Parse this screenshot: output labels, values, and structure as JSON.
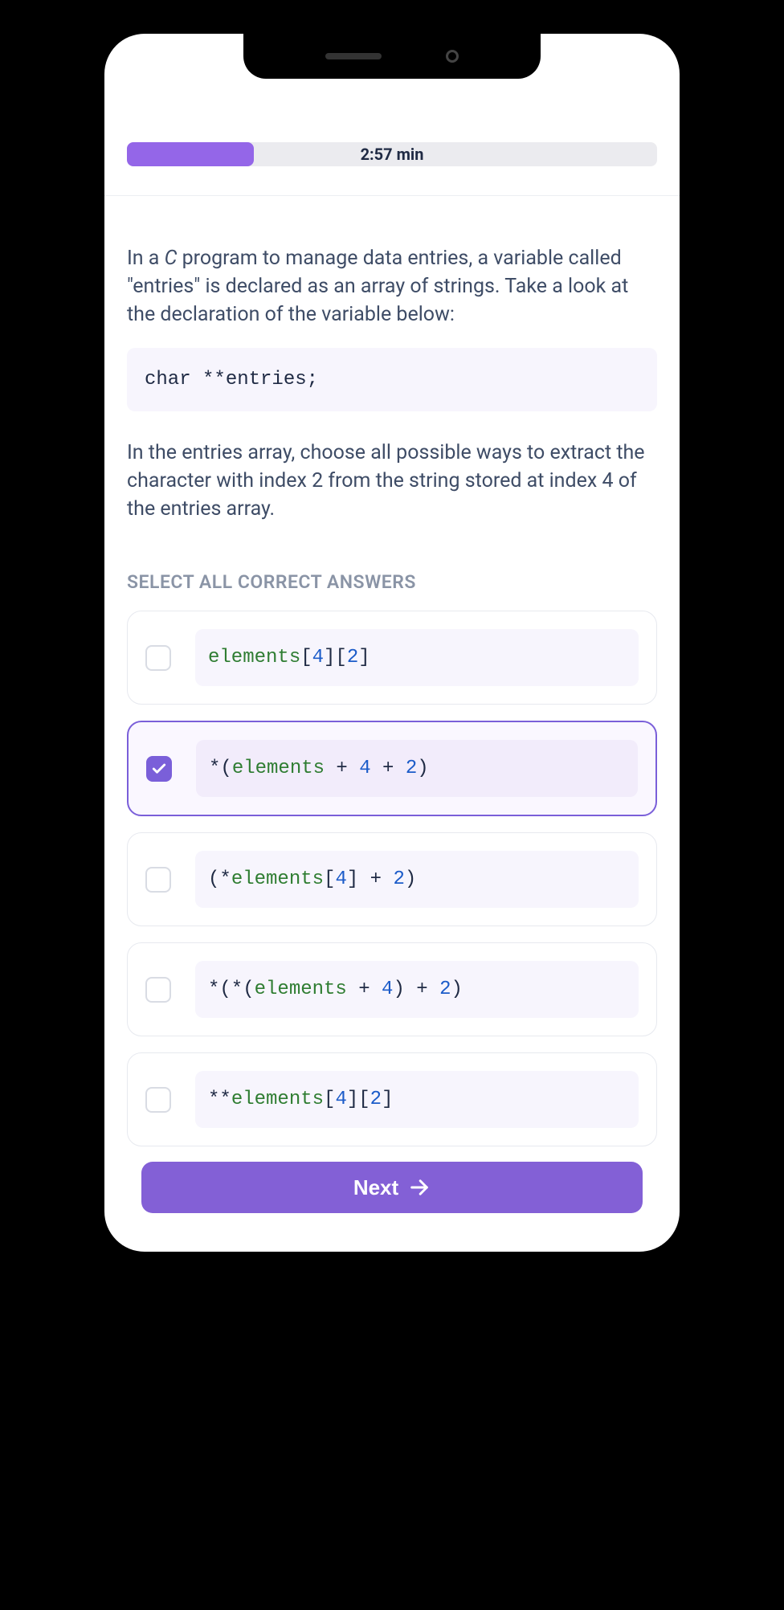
{
  "progress": {
    "time_label": "2:57 min",
    "fill_percent": 24
  },
  "question": {
    "para1_prefix": "In a ",
    "para1_lang": "C",
    "para1_rest": " program to manage data entries, a variable called \"entries\" is declared as an array of strings. Take a look at the declaration of the variable below:",
    "code_decl": "char **entries;",
    "para2": "In the entries array, choose all possible ways to extract the character with index 2 from the string stored at index 4 of the entries array."
  },
  "section_label": "SELECT ALL CORRECT ANSWERS",
  "options": [
    {
      "selected": false,
      "tokens": [
        {
          "t": "ident",
          "v": "elements"
        },
        {
          "t": "plain",
          "v": "["
        },
        {
          "t": "num",
          "v": "4"
        },
        {
          "t": "plain",
          "v": "]["
        },
        {
          "t": "num",
          "v": "2"
        },
        {
          "t": "plain",
          "v": "]"
        }
      ]
    },
    {
      "selected": true,
      "tokens": [
        {
          "t": "plain",
          "v": "*("
        },
        {
          "t": "ident",
          "v": "elements"
        },
        {
          "t": "plain",
          "v": " + "
        },
        {
          "t": "num",
          "v": "4"
        },
        {
          "t": "plain",
          "v": " + "
        },
        {
          "t": "num",
          "v": "2"
        },
        {
          "t": "plain",
          "v": ")"
        }
      ]
    },
    {
      "selected": false,
      "tokens": [
        {
          "t": "plain",
          "v": "(*"
        },
        {
          "t": "ident",
          "v": "elements"
        },
        {
          "t": "plain",
          "v": "["
        },
        {
          "t": "num",
          "v": "4"
        },
        {
          "t": "plain",
          "v": "] + "
        },
        {
          "t": "num",
          "v": "2"
        },
        {
          "t": "plain",
          "v": ")"
        }
      ]
    },
    {
      "selected": false,
      "tokens": [
        {
          "t": "plain",
          "v": "*(*("
        },
        {
          "t": "ident",
          "v": "elements"
        },
        {
          "t": "plain",
          "v": " + "
        },
        {
          "t": "num",
          "v": "4"
        },
        {
          "t": "plain",
          "v": ") + "
        },
        {
          "t": "num",
          "v": "2"
        },
        {
          "t": "plain",
          "v": ")"
        }
      ]
    },
    {
      "selected": false,
      "tokens": [
        {
          "t": "plain",
          "v": "**"
        },
        {
          "t": "ident",
          "v": "elements"
        },
        {
          "t": "plain",
          "v": "["
        },
        {
          "t": "num",
          "v": "4"
        },
        {
          "t": "plain",
          "v": "]["
        },
        {
          "t": "num",
          "v": "2"
        },
        {
          "t": "plain",
          "v": "]"
        }
      ]
    }
  ],
  "next_label": "Next"
}
